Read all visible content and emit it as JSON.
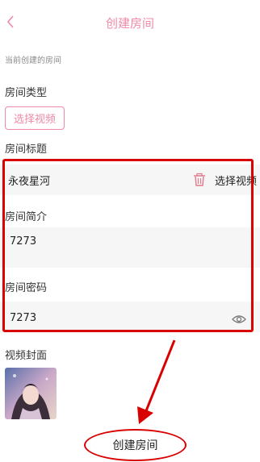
{
  "header": {
    "back_icon": "chevron-left-icon",
    "title": "创建房间"
  },
  "current_label": "当前创建的房间",
  "room_type": {
    "label": "房间类型",
    "button_label": "选择视频"
  },
  "room_title": {
    "label": "房间标题",
    "value": "永夜星河",
    "delete_icon": "trash-icon",
    "select_video_label": "选择视频"
  },
  "room_intro": {
    "label": "房间简介",
    "value": "7273"
  },
  "room_password": {
    "label": "房间密码",
    "value": "7273",
    "visibility_icon": "eye-icon"
  },
  "video_cover": {
    "label": "视频封面"
  },
  "create_button": {
    "label": "创建房间"
  },
  "colors": {
    "accent": "#f08aa6",
    "annotation_red": "#d90000",
    "field_bg": "#f6f6f6"
  }
}
